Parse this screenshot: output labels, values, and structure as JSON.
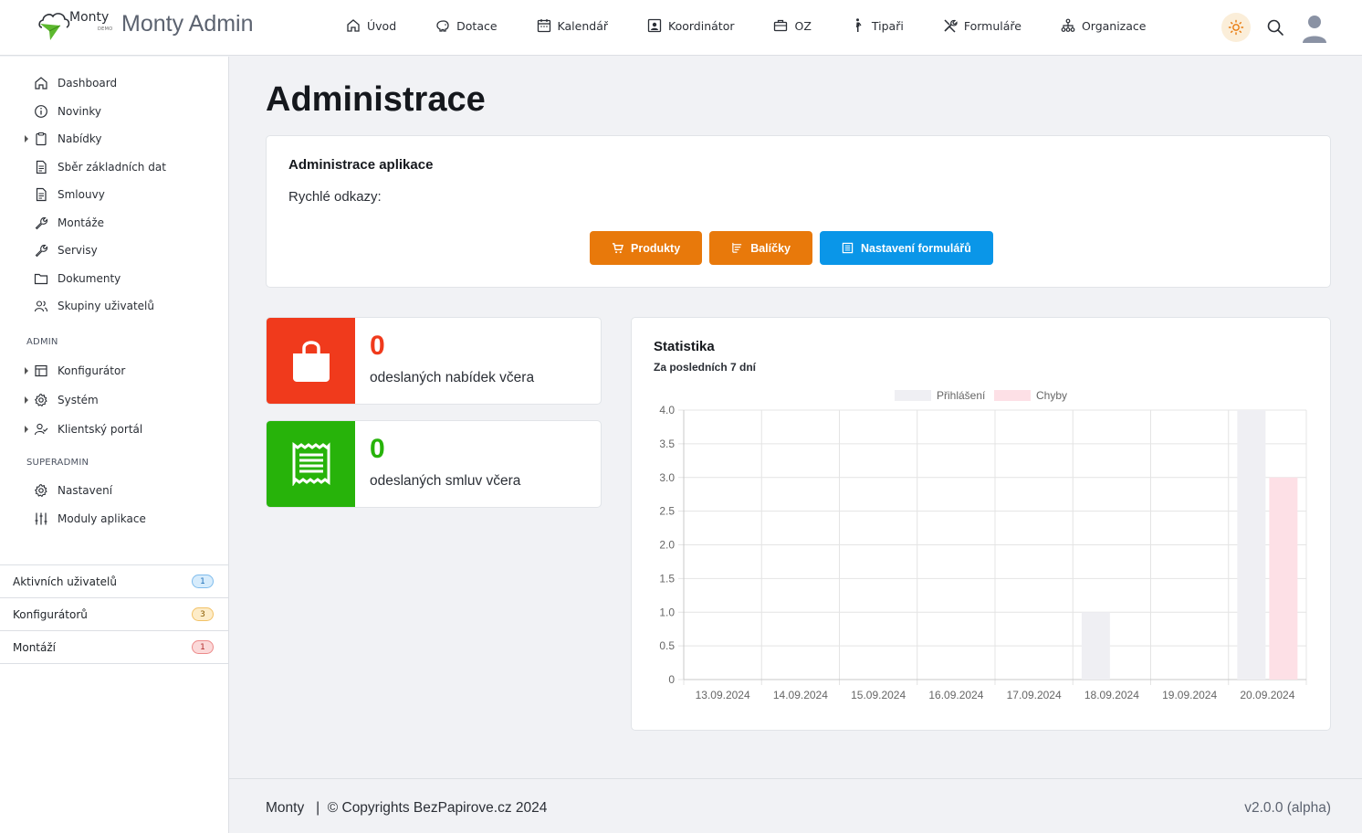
{
  "header": {
    "logo_text": "Monty",
    "logo_demo": "DEMO",
    "app_title": "Monty Admin",
    "nav": [
      {
        "label": "Úvod",
        "icon": "home-icon"
      },
      {
        "label": "Dotace",
        "icon": "piggy-bank-icon"
      },
      {
        "label": "Kalendář",
        "icon": "calendar-icon"
      },
      {
        "label": "Koordinátor",
        "icon": "contact-card-icon"
      },
      {
        "label": "OZ",
        "icon": "briefcase-icon"
      },
      {
        "label": "Tipaři",
        "icon": "person-walking-icon"
      },
      {
        "label": "Formuláře",
        "icon": "tools-icon"
      },
      {
        "label": "Organizace",
        "icon": "org-chart-icon"
      }
    ]
  },
  "sidebar": {
    "items": [
      {
        "label": "Dashboard",
        "icon": "home-icon",
        "expandable": false
      },
      {
        "label": "Novinky",
        "icon": "info-icon",
        "expandable": false
      },
      {
        "label": "Nabídky",
        "icon": "clipboard-icon",
        "expandable": true
      },
      {
        "label": "Sběr základních dat",
        "icon": "document-icon",
        "expandable": false
      },
      {
        "label": "Smlouvy",
        "icon": "document-icon",
        "expandable": false
      },
      {
        "label": "Montáže",
        "icon": "wrench-icon",
        "expandable": false
      },
      {
        "label": "Servisy",
        "icon": "wrench-icon",
        "expandable": false
      },
      {
        "label": "Dokumenty",
        "icon": "folder-icon",
        "expandable": false
      },
      {
        "label": "Skupiny uživatelů",
        "icon": "users-icon",
        "expandable": false
      }
    ],
    "admin_heading": "ADMIN",
    "admin_items": [
      {
        "label": "Konfigurátor",
        "icon": "layout-icon",
        "expandable": true
      },
      {
        "label": "Systém",
        "icon": "gear-icon",
        "expandable": true
      },
      {
        "label": "Klientský portál",
        "icon": "user-check-icon",
        "expandable": true
      }
    ],
    "superadmin_heading": "SUPERADMIN",
    "superadmin_items": [
      {
        "label": "Nastavení",
        "icon": "gear-icon"
      },
      {
        "label": "Moduly aplikace",
        "icon": "sliders-icon"
      }
    ],
    "stats": [
      {
        "label": "Aktivních uživatelů",
        "count": "1",
        "color": "#1e88e5",
        "bg": "#d7ecfc"
      },
      {
        "label": "Konfigurátorů",
        "count": "3",
        "color": "#c77d00",
        "bg": "#fdecc8"
      },
      {
        "label": "Montáží",
        "count": "1",
        "color": "#d33a3a",
        "bg": "#fbd9d9"
      }
    ]
  },
  "main": {
    "title": "Administrace",
    "admin_card": {
      "title": "Administrace aplikace",
      "quick_links_label": "Rychlé odkazy:",
      "buttons": [
        {
          "label": "Produkty",
          "icon": "cart-icon",
          "color": "#e8790b"
        },
        {
          "label": "Balíčky",
          "icon": "list-tree-icon",
          "color": "#e8790b"
        },
        {
          "label": "Nastavení formulářů",
          "icon": "form-icon",
          "color": "#0a96e8"
        }
      ]
    },
    "kpis": [
      {
        "value": "0",
        "label": "odeslaných nabídek včera",
        "color": "#f03a1c",
        "icon": "shopping-bag-icon"
      },
      {
        "value": "0",
        "label": "odeslaných smluv včera",
        "color": "#27b30a",
        "icon": "receipt-icon"
      }
    ]
  },
  "chart_data": {
    "type": "bar",
    "title": "Statistika",
    "subtitle": "Za posledních 7 dní",
    "categories": [
      "13.09.2024",
      "14.09.2024",
      "15.09.2024",
      "16.09.2024",
      "17.09.2024",
      "18.09.2024",
      "19.09.2024",
      "20.09.2024"
    ],
    "series": [
      {
        "name": "Přihlášení",
        "values": [
          0,
          0,
          0,
          0,
          0,
          1,
          0,
          4
        ],
        "color": "#efeff3"
      },
      {
        "name": "Chyby",
        "values": [
          0,
          0,
          0,
          0,
          0,
          0,
          0,
          3
        ],
        "color": "#fde0e6"
      }
    ],
    "ylim": [
      0,
      4
    ],
    "yticks": [
      "0",
      "0.5",
      "1.0",
      "1.5",
      "2.0",
      "2.5",
      "3.0",
      "3.5",
      "4.0"
    ],
    "grid": true,
    "legend": "top-center"
  },
  "footer": {
    "left": "Monty   |  © Copyrights BezPapirove.cz 2024",
    "version": "v2.0.0 (alpha)"
  }
}
